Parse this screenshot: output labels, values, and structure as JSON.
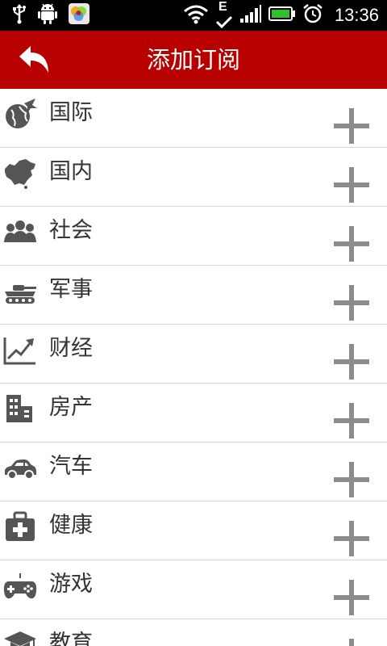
{
  "status_bar": {
    "time": "13:36",
    "network_label": "E",
    "icons": [
      "usb-icon",
      "android-debug-icon",
      "photo-app-icon",
      "wifi-icon",
      "signal-icon",
      "battery-icon",
      "alarm-icon"
    ],
    "battery_color": "#2fbf2f"
  },
  "header": {
    "title": "添加订阅",
    "background_color": "#b80000",
    "back_icon": "back-arrow-icon"
  },
  "categories": [
    {
      "label": "国际",
      "icon": "globe-plane-icon"
    },
    {
      "label": "国内",
      "icon": "china-map-icon"
    },
    {
      "label": "社会",
      "icon": "people-group-icon"
    },
    {
      "label": "军事",
      "icon": "tank-icon"
    },
    {
      "label": "财经",
      "icon": "trend-chart-icon"
    },
    {
      "label": "房产",
      "icon": "building-icon"
    },
    {
      "label": "汽车",
      "icon": "car-icon"
    },
    {
      "label": "健康",
      "icon": "medical-kit-icon"
    },
    {
      "label": "游戏",
      "icon": "gamepad-icon"
    },
    {
      "label": "教育",
      "icon": "graduation-cap-icon"
    }
  ],
  "add_icon": "plus-icon"
}
